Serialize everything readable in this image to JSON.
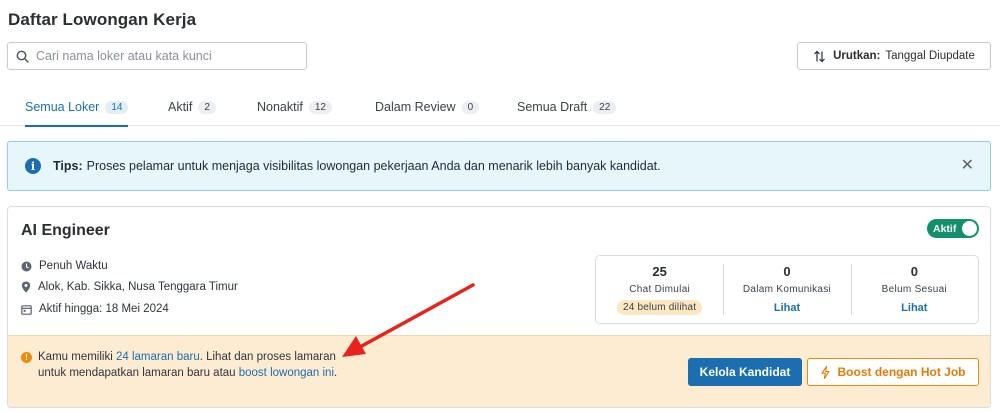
{
  "page": {
    "title": "Daftar Lowongan Kerja"
  },
  "search": {
    "placeholder": "Cari nama loker atau kata kunci",
    "value": ""
  },
  "sort": {
    "label": "Urutkan:",
    "value": "Tanggal Diupdate"
  },
  "tabs": [
    {
      "label": "Semua Loker",
      "count": "14",
      "active": true
    },
    {
      "label": "Aktif",
      "count": "2"
    },
    {
      "label": "Nonaktif",
      "count": "12"
    },
    {
      "label": "Dalam Review",
      "count": "0"
    },
    {
      "label": "Semua Draft",
      "count": "22"
    }
  ],
  "tips": {
    "label": "Tips:",
    "text": "Proses pelamar untuk menjaga visibilitas lowongan pekerjaan Anda dan menarik lebih banyak kandidat."
  },
  "job": {
    "title": "AI Engineer",
    "status_label": "Aktif",
    "status_on": true,
    "employment_type": "Penuh Waktu",
    "location": "Alok, Kab. Sikka, Nusa Tenggara Timur",
    "active_until": "Aktif hingga: 18 Mei 2024",
    "stats": [
      {
        "value": "25",
        "label": "Chat Dimulai",
        "badge": "24 belum dilihat"
      },
      {
        "value": "0",
        "label": "Dalam Komunikasi",
        "link": "Lihat"
      },
      {
        "value": "0",
        "label": "Belum Sesuai",
        "link": "Lihat"
      }
    ],
    "notice": {
      "prefix": "Kamu memiliki ",
      "link1": "24 lamaran baru",
      "middle": ". Lihat dan proses lamaran untuk mendapatkan lamaran baru atau ",
      "link2": "boost lowongan ini",
      "suffix": "."
    },
    "manage_button": "Kelola Kandidat",
    "boost_button": "Boost dengan Hot Job"
  },
  "colors": {
    "primary": "#1b6fb0",
    "active_toggle": "#11906b",
    "notice_bg": "#fdecd2",
    "boost": "#e57b05",
    "annotation_arrow": "#e8231b"
  },
  "icons": [
    "search-icon",
    "sort-icon",
    "info-icon",
    "close-icon",
    "clock-icon",
    "location-pin-icon",
    "calendar-icon",
    "warning-icon",
    "lightning-icon"
  ]
}
